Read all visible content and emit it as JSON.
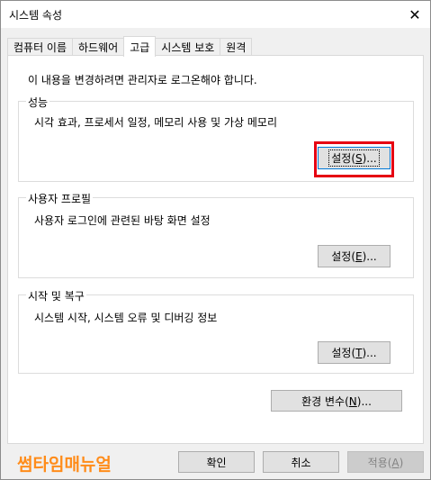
{
  "window": {
    "title": "시스템 속성",
    "close_glyph": "✕"
  },
  "tabs": [
    "컴퓨터 이름",
    "하드웨어",
    "고급",
    "시스템 보호",
    "원격"
  ],
  "active_tab": "고급",
  "notice": "이 내용을 변경하려면 관리자로 로그온해야 합니다.",
  "performance": {
    "title": "성능",
    "description": "시각 효과, 프로세서 일정, 메모리 사용 및 가상 메모리",
    "button_prefix": "설정(",
    "button_hotkey": "S",
    "button_suffix": ")..."
  },
  "profiles": {
    "title": "사용자 프로필",
    "description": "사용자 로그인에 관련된 바탕 화면 설정",
    "button_prefix": "설정(",
    "button_hotkey": "E",
    "button_suffix": ")..."
  },
  "startup": {
    "title": "시작 및 복구",
    "description": "시스템 시작, 시스템 오류 및 디버깅 정보",
    "button_prefix": "설정(",
    "button_hotkey": "T",
    "button_suffix": ")..."
  },
  "env_button": {
    "prefix": "환경 변수(",
    "hotkey": "N",
    "suffix": ")..."
  },
  "footer": {
    "ok": "확인",
    "cancel": "취소",
    "apply_prefix": "적용(",
    "apply_hotkey": "A",
    "apply_suffix": ")"
  },
  "watermark": "썸타임매뉴얼",
  "colors": {
    "highlight": "#e60012",
    "watermark": "#ff8c1a",
    "focus": "#0078d7"
  }
}
